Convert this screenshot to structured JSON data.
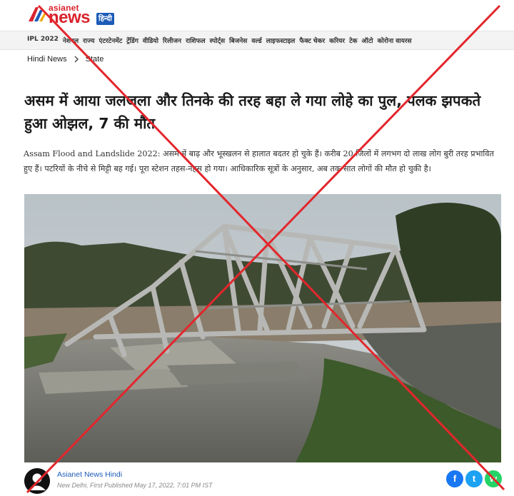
{
  "brand": {
    "small": "asianet",
    "big": "news",
    "badge": "हिन्दी"
  },
  "nav": {
    "items": [
      "IPL 2022",
      "नेशनल",
      "राज्य",
      "एंटरटेनमेंट",
      "ट्रेंडिंग",
      "वीडियो",
      "रिलीजन",
      "राशिफल",
      "स्पोर्ट्स",
      "बिजनेस",
      "वर्ल्ड",
      "लाइफस्टाइल",
      "फैक्ट चेकर",
      "करियर",
      "टेक",
      "ऑटो",
      "कोरोना वायरस"
    ]
  },
  "breadcrumb": {
    "home": "Hindi News",
    "section": "State"
  },
  "article": {
    "headline": "असम में आया जलजला और तिनके की तरह बहा ले गया लोहे का पुल, पलक झपकते हुआ ओझल, 7 की मौत",
    "summary": "Assam Flood and Landslide 2022: असम में बाढ़ और भूस्खलन से हालात बदतर हो चुके हैं। करीब 20 जिलों में लगभग दो लाख लोग बुरी तरह प्रभावित हुए हैं। पटरियों के नीचे से मिट्टी बह गई। पूरा स्टेशन तहस-नहस हो गया। आधिकारिक सूत्रों के अनुसार, अब तक सात लोगों की मौत हो चुकी है।"
  },
  "author": {
    "name": "Asianet News Hindi",
    "meta": "New Delhi, First Published May 17, 2022, 7:01 PM IST"
  },
  "share": {
    "facebook": "f",
    "twitter": "t",
    "whatsapp": "w"
  },
  "colors": {
    "brand_red": "#d9232d",
    "brand_blue": "#1c5bb8",
    "cross_red": "#e3262c"
  },
  "icons": {
    "logo": "asianet-logo-mark",
    "separator": "chevron-right-icon",
    "facebook": "facebook-icon",
    "twitter": "twitter-icon",
    "whatsapp": "whatsapp-icon"
  }
}
